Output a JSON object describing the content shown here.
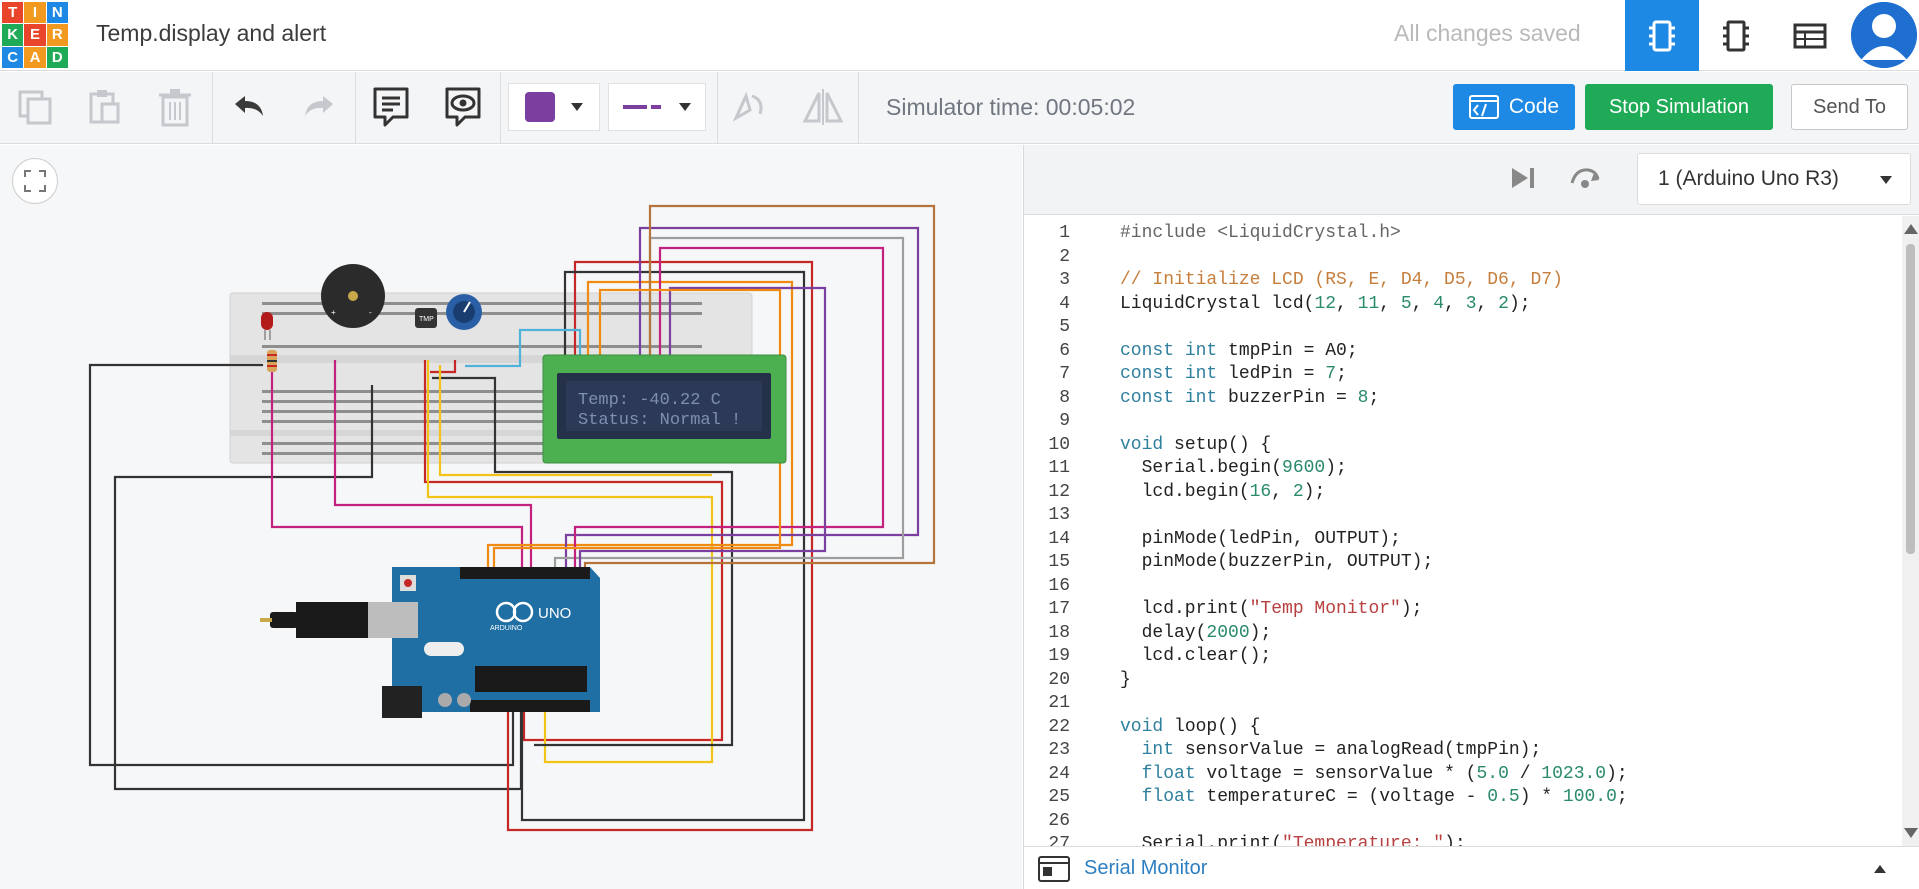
{
  "header": {
    "logo_letters": [
      "T",
      "I",
      "N",
      "K",
      "E",
      "R",
      "C",
      "A",
      "D"
    ],
    "logo_colors": [
      "#e8452a",
      "#f29a1f",
      "#1e88e5",
      "#1eaa57",
      "#e8452a",
      "#f29a1f",
      "#1e88e5",
      "#f29a1f",
      "#1eaa57"
    ],
    "project_title": "Temp.display and alert",
    "save_status": "All changes saved",
    "views": [
      "circuit-view-icon",
      "schematic-view-icon",
      "component-list-icon"
    ],
    "avatar": "user-avatar"
  },
  "toolbar": {
    "icons": [
      "copy-icon",
      "paste-icon",
      "delete-icon",
      "undo-icon",
      "redo-icon",
      "note-icon",
      "notes-visibility-icon",
      "color-swatch-icon",
      "line-style-icon",
      "rotate-icon",
      "flip-icon"
    ],
    "color_swatch": "#7b3fa0",
    "simulator_time": "Simulator time: 00:05:02",
    "code_label": "Code",
    "stop_label": "Stop Simulation",
    "send_label": "Send To",
    "code_color": "#1e88e5",
    "stop_color": "#1eaa57"
  },
  "canvas": {
    "fit_icon": "fit-view-icon",
    "lcd_line1": "Temp: -40.22 C",
    "lcd_line2": "Status: Normal !",
    "arduino_brand": "ARDUINO",
    "arduino_model": "UNO",
    "sensor_label": "TMP"
  },
  "code_panel": {
    "controls": [
      "step-icon",
      "resume-icon"
    ],
    "board_select": "1 (Arduino Uno R3)",
    "serial_label": "Serial Monitor",
    "lines": [
      {
        "n": "1",
        "t": "#include <LiquidCrystal.h>"
      },
      {
        "n": "2",
        "t": ""
      },
      {
        "n": "3",
        "t": "// Initialize LCD (RS, E, D4, D5, D6, D7)"
      },
      {
        "n": "4",
        "t": "LiquidCrystal lcd(12, 11, 5, 4, 3, 2);"
      },
      {
        "n": "5",
        "t": ""
      },
      {
        "n": "6",
        "t": "const int tmpPin = A0;"
      },
      {
        "n": "7",
        "t": "const int ledPin = 7;"
      },
      {
        "n": "8",
        "t": "const int buzzerPin = 8;"
      },
      {
        "n": "9",
        "t": ""
      },
      {
        "n": "10",
        "t": "void setup() {"
      },
      {
        "n": "11",
        "t": "  Serial.begin(9600);"
      },
      {
        "n": "12",
        "t": "  lcd.begin(16, 2);"
      },
      {
        "n": "13",
        "t": ""
      },
      {
        "n": "14",
        "t": "  pinMode(ledPin, OUTPUT);"
      },
      {
        "n": "15",
        "t": "  pinMode(buzzerPin, OUTPUT);"
      },
      {
        "n": "16",
        "t": ""
      },
      {
        "n": "17",
        "t": "  lcd.print(\"Temp Monitor\");"
      },
      {
        "n": "18",
        "t": "  delay(2000);"
      },
      {
        "n": "19",
        "t": "  lcd.clear();"
      },
      {
        "n": "20",
        "t": "}"
      },
      {
        "n": "21",
        "t": ""
      },
      {
        "n": "22",
        "t": "void loop() {"
      },
      {
        "n": "23",
        "t": "  int sensorValue = analogRead(tmpPin);"
      },
      {
        "n": "24",
        "t": "  float voltage = sensorValue * (5.0 / 1023.0);"
      },
      {
        "n": "25",
        "t": "  float temperatureC = (voltage - 0.5) * 100.0;"
      },
      {
        "n": "26",
        "t": ""
      },
      {
        "n": "27",
        "t": "  Serial.print(\"Temperature: \");"
      }
    ]
  }
}
